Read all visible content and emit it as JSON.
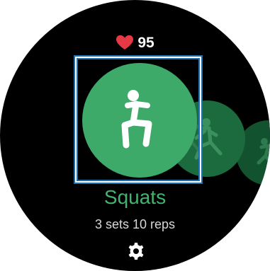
{
  "heart_rate": {
    "icon": "heart-icon",
    "value": "95",
    "color": "#e63946"
  },
  "carousel": {
    "selected": {
      "icon": "squat-icon",
      "name": "Squats",
      "detail": "3 sets 10 reps",
      "color": "#3eaa69"
    },
    "next_items": [
      {
        "icon": "lunge-icon"
      },
      {
        "icon": "jump-icon"
      }
    ]
  },
  "title_color": "#43b46f",
  "settings": {
    "icon": "gear-icon"
  }
}
